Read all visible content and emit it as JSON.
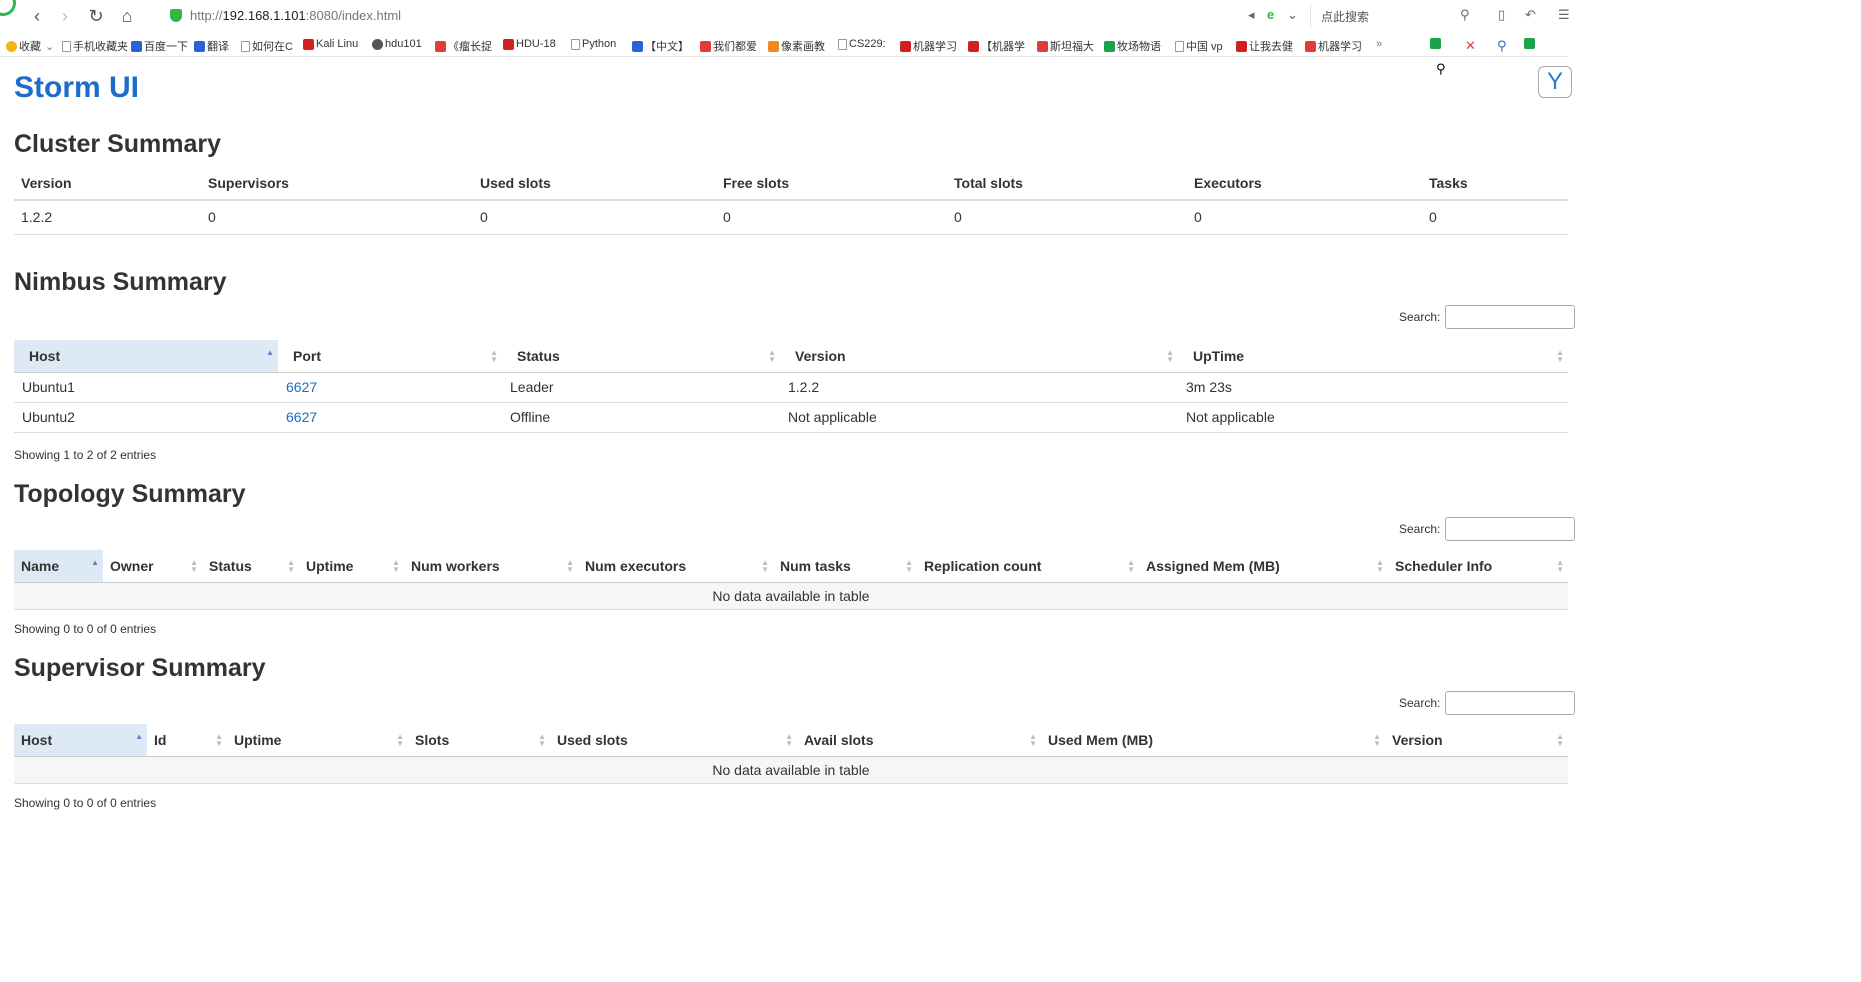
{
  "browser": {
    "url_prefix": "http://",
    "url_host": "192.168.1.101",
    "url_rest": ":8080/index.html",
    "search_placeholder": "点此搜索",
    "bookmarks": [
      "收藏",
      "手机收藏夹",
      "百度一下",
      "翻译",
      "如何在C",
      "Kali Linu",
      "hdu101",
      "《瘤长捉",
      "HDU-18",
      "Python",
      "【中文】",
      "我们都爱",
      "像素画教",
      "CS229:",
      "机器学习",
      "【机器学",
      "斯坦福大",
      "牧场物语",
      "中国 vp",
      "让我去健",
      "机器学习"
    ],
    "more": "»"
  },
  "page": {
    "title": "Storm UI"
  },
  "cluster": {
    "heading": "Cluster Summary",
    "columns": [
      "Version",
      "Supervisors",
      "Used slots",
      "Free slots",
      "Total slots",
      "Executors",
      "Tasks"
    ],
    "row": [
      "1.2.2",
      "0",
      "0",
      "0",
      "0",
      "0",
      "0"
    ]
  },
  "nimbus": {
    "heading": "Nimbus Summary",
    "search_label": "Search:",
    "columns": [
      "Host",
      "Port",
      "Status",
      "Version",
      "UpTime"
    ],
    "rows": [
      [
        "Ubuntu1",
        "6627",
        "Leader",
        "1.2.2",
        "3m 23s"
      ],
      [
        "Ubuntu2",
        "6627",
        "Offline",
        "Not applicable",
        "Not applicable"
      ]
    ],
    "info": "Showing 1 to 2 of 2 entries"
  },
  "topology": {
    "heading": "Topology Summary",
    "search_label": "Search:",
    "columns": [
      "Name",
      "Owner",
      "Status",
      "Uptime",
      "Num workers",
      "Num executors",
      "Num tasks",
      "Replication count",
      "Assigned Mem (MB)",
      "Scheduler Info"
    ],
    "empty": "No data available in table",
    "info": "Showing 0 to 0 of 0 entries"
  },
  "supervisor": {
    "heading": "Supervisor Summary",
    "search_label": "Search:",
    "columns": [
      "Host",
      "Id",
      "Uptime",
      "Slots",
      "Used slots",
      "Avail slots",
      "Used Mem (MB)",
      "Version"
    ],
    "empty": "No data available in table",
    "info": "Showing 0 to 0 of 0 entries"
  }
}
